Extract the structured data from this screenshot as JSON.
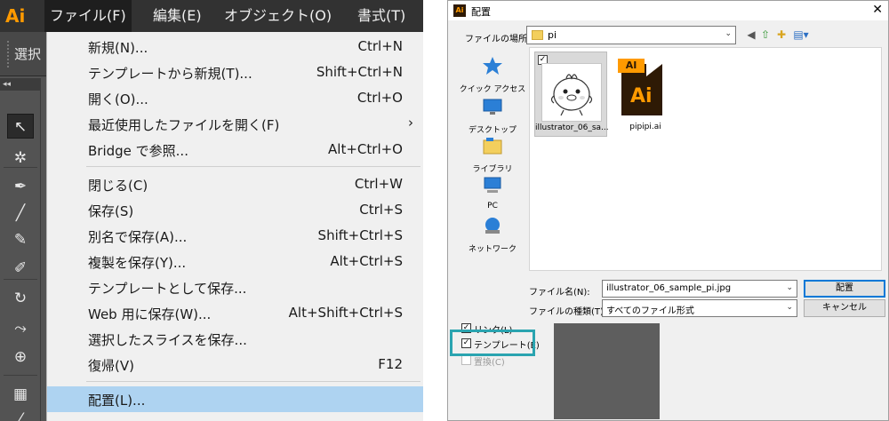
{
  "illustrator": {
    "logo": "Ai",
    "menubar": [
      {
        "label": "ファイル(F)",
        "active": true
      },
      {
        "label": "編集(E)",
        "active": false
      },
      {
        "label": "オブジェクト(O)",
        "active": false
      },
      {
        "label": "書式(T)",
        "active": false
      }
    ],
    "control_bar_label": "選択",
    "toolbar_header": "◂◂",
    "tools": [
      {
        "icon": "selection-arrow-icon",
        "glyph": "↖"
      },
      {
        "icon": "magic-wand-icon",
        "glyph": "✲"
      },
      {
        "icon": "pen-tool-icon",
        "glyph": "✒"
      },
      {
        "icon": "line-tool-icon",
        "glyph": "╱"
      },
      {
        "icon": "paintbrush-icon",
        "glyph": "✎"
      },
      {
        "icon": "shaper-tool-icon",
        "glyph": "✐"
      },
      {
        "icon": "rotate-tool-icon",
        "glyph": "↻"
      },
      {
        "icon": "width-tool-icon",
        "glyph": "⤳"
      },
      {
        "icon": "free-transform-icon",
        "glyph": "⊕"
      },
      {
        "icon": "shape-builder-icon",
        "glyph": "▦"
      },
      {
        "icon": "eyedropper-icon",
        "glyph": "⁄"
      }
    ],
    "file_menu": {
      "groups": [
        [
          {
            "label": "新規(N)...",
            "shortcut": "Ctrl+N"
          },
          {
            "label": "テンプレートから新規(T)...",
            "shortcut": "Shift+Ctrl+N"
          },
          {
            "label": "開く(O)...",
            "shortcut": "Ctrl+O"
          },
          {
            "label": "最近使用したファイルを開く(F)",
            "shortcut": "",
            "submenu": true
          },
          {
            "label": "Bridge で参照...",
            "shortcut": "Alt+Ctrl+O"
          }
        ],
        [
          {
            "label": "閉じる(C)",
            "shortcut": "Ctrl+W"
          },
          {
            "label": "保存(S)",
            "shortcut": "Ctrl+S"
          },
          {
            "label": "別名で保存(A)...",
            "shortcut": "Shift+Ctrl+S"
          },
          {
            "label": "複製を保存(Y)...",
            "shortcut": "Alt+Ctrl+S"
          },
          {
            "label": "テンプレートとして保存...",
            "shortcut": ""
          },
          {
            "label": "Web 用に保存(W)...",
            "shortcut": "Alt+Shift+Ctrl+S"
          },
          {
            "label": "選択したスライスを保存...",
            "shortcut": ""
          },
          {
            "label": "復帰(V)",
            "shortcut": "F12"
          }
        ],
        [
          {
            "label": "配置(L)...",
            "shortcut": "",
            "highlighted": true
          }
        ]
      ]
    }
  },
  "place_dialog": {
    "title_icon": "Ai",
    "title": "配置",
    "close_glyph": "✕",
    "location_label": "ファイルの場所(I):",
    "location_value": "pi",
    "nav_glyphs": {
      "back": "◀",
      "up": "⇧",
      "new_folder": "✚",
      "view": "▤▾"
    },
    "places": [
      {
        "icon": "quick-access-star-icon",
        "label": "クイック アクセス",
        "color": "#2b7fd6"
      },
      {
        "icon": "desktop-icon",
        "label": "デスクトップ",
        "color": "#2b7fd6"
      },
      {
        "icon": "library-icon",
        "label": "ライブラリ",
        "color": "#f3cf5d"
      },
      {
        "icon": "pc-icon",
        "label": "PC",
        "color": "#2b7fd6"
      },
      {
        "icon": "network-icon",
        "label": "ネットワーク",
        "color": "#2b7fd6"
      }
    ],
    "files": [
      {
        "name": "illustrator_06_sa...",
        "selected": true,
        "checked": true,
        "kind": "jpg"
      },
      {
        "name": "pipipi.ai",
        "selected": false,
        "checked": false,
        "kind": "ai",
        "badge": "AI",
        "logo": "Ai"
      }
    ],
    "filename_label": "ファイル名(N):",
    "filename_value": "illustrator_06_sample_pi.jpg",
    "filetype_label": "ファイルの種類(T):",
    "filetype_value": "すべてのファイル形式",
    "place_button": "配置",
    "cancel_button": "キャンセル",
    "options": [
      {
        "label": "リンク(L)",
        "checked": true,
        "enabled": true
      },
      {
        "label": "テンプレート(E)",
        "checked": true,
        "enabled": true
      },
      {
        "label": "置換(C)",
        "checked": false,
        "enabled": false
      }
    ],
    "colors": {
      "highlight": "#2aa4b0",
      "selection": "#aed3f1",
      "ai_orange": "#ff9a00"
    }
  }
}
